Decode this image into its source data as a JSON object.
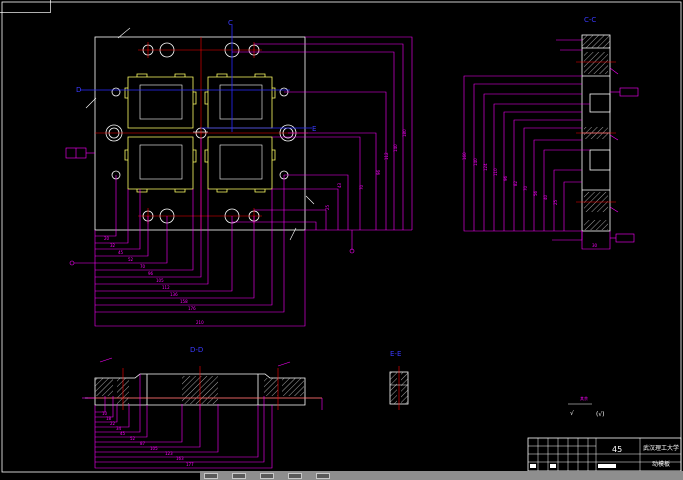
{
  "colors": {
    "background": "#000000",
    "dimension": "#ff00ff",
    "outline": "#ffffff",
    "centerline": "#ff0000",
    "axis": "#0000ff",
    "cavity": "#ffff66",
    "hatch": "#cccccc",
    "section_label": "#3a3aff"
  },
  "sections": {
    "top_right": "C-C",
    "bottom_left": "D-D",
    "bottom_mid": "E-E"
  },
  "titleblock": {
    "sheet_number": "45",
    "school": "武汉理工大学",
    "part_name": "动模板"
  },
  "notes": {
    "roughness": "其余",
    "symbol": "√"
  },
  "status_icons": [
    "paper-icon",
    "layout-icon",
    "snap-icon",
    "grid-icon",
    "ortho-icon"
  ]
}
